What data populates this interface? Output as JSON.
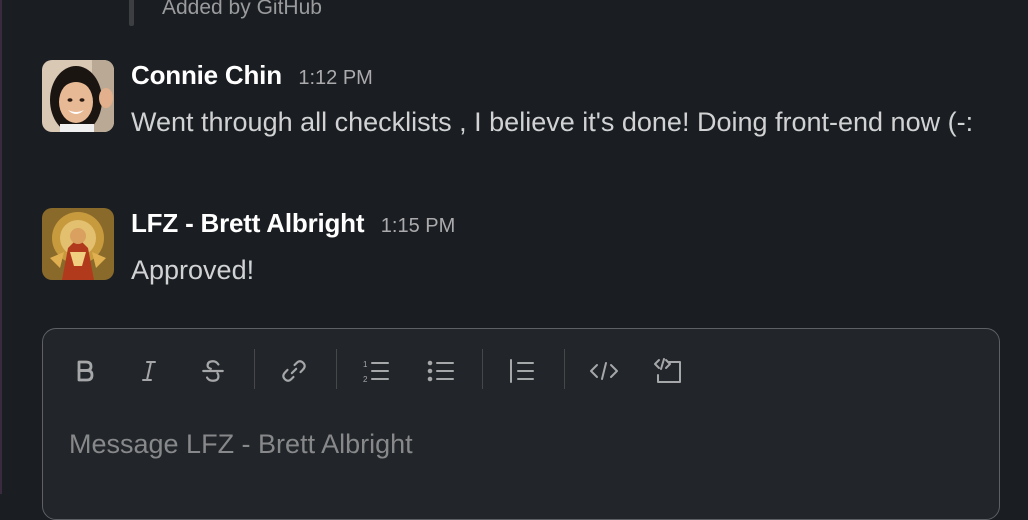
{
  "previous_attachment": {
    "text": "Added by GitHub"
  },
  "messages": [
    {
      "author": "Connie Chin",
      "time": "1:12 PM",
      "text": "Went through all checklists , I believe it's done! Doing front-end now (-:"
    },
    {
      "author": "LFZ - Brett Albright",
      "time": "1:15 PM",
      "text": "Approved!"
    }
  ],
  "composer": {
    "placeholder": "Message LFZ - Brett Albright",
    "toolbar": [
      "bold-icon",
      "italic-icon",
      "strikethrough-icon",
      "link-icon",
      "ordered-list-icon",
      "bulleted-list-icon",
      "blockquote-icon",
      "code-icon",
      "code-block-icon"
    ]
  },
  "colors": {
    "background": "#1a1d21",
    "author": "#ffffff",
    "text": "#d1d2d3",
    "composer_border": "#5e6064"
  }
}
